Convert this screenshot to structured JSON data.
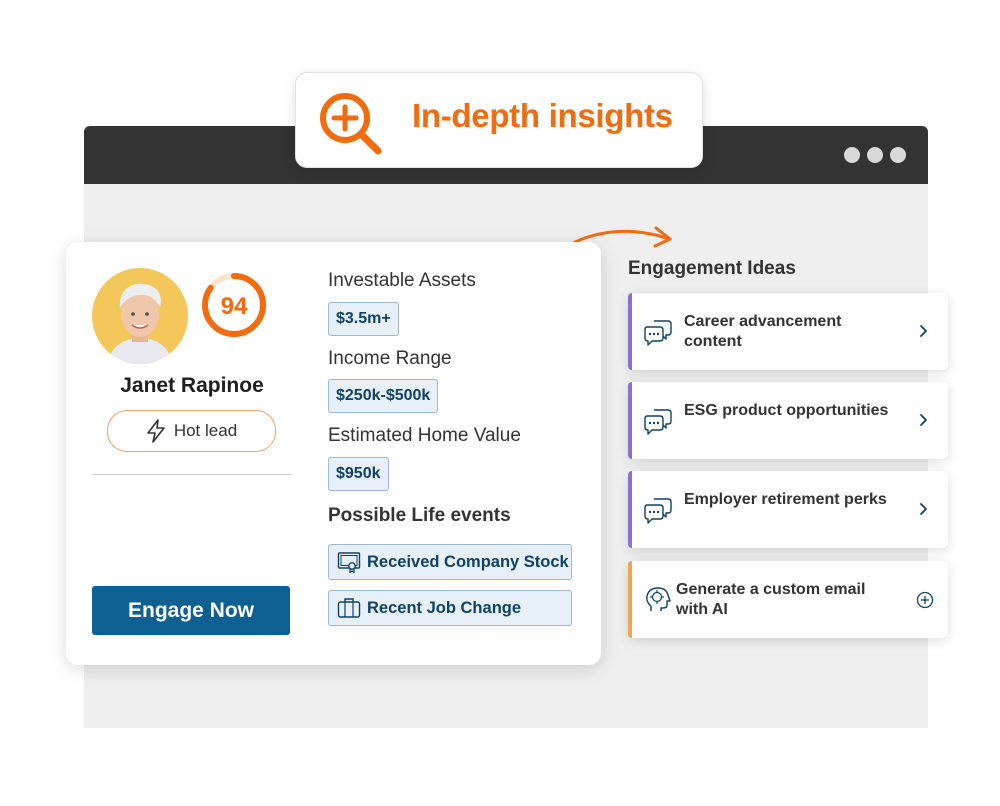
{
  "badge": {
    "title": "In-depth insights",
    "icon": "search-plus-icon"
  },
  "browser": {
    "menu_icon": "more-dots-icon"
  },
  "profile": {
    "name": "Janet Rapinoe",
    "score": "94",
    "score_fraction": 0.85,
    "status": "Hot lead",
    "engage_label": "Engage Now"
  },
  "insights": {
    "investable_assets_label": "Investable Assets",
    "investable_assets_value": "$3.5m+",
    "income_range_label": "Income Range",
    "income_range_value": "$250k-$500k",
    "home_value_label": "Estimated Home Value",
    "home_value_value": "$950k",
    "life_events_label": "Possible Life events",
    "life_events": [
      {
        "label": "Received Company Stock",
        "icon": "stock-certificate-icon"
      },
      {
        "label": "Recent Job Change",
        "icon": "briefcase-icon"
      }
    ]
  },
  "engagement": {
    "title": "Engagement Ideas",
    "ideas": [
      {
        "label": "Career advancement content",
        "icon": "chat-bubbles-icon",
        "action": "chevron-right"
      },
      {
        "label": "ESG product opportunities",
        "icon": "chat-bubbles-icon",
        "action": "chevron-right"
      },
      {
        "label": "Employer retirement perks",
        "icon": "chat-bubbles-icon",
        "action": "chevron-right"
      },
      {
        "label": "Generate a custom email with AI",
        "icon": "ai-brain-icon",
        "action": "plus-circle"
      }
    ]
  },
  "colors": {
    "accent_orange": "#f26b0f",
    "primary_blue": "#0e5f92",
    "chip_text": "#0e4266",
    "chip_bg": "#e7eff8",
    "idea_accent_purple": "#8a6fcf",
    "idea_accent_orange": "#f0a64a"
  }
}
